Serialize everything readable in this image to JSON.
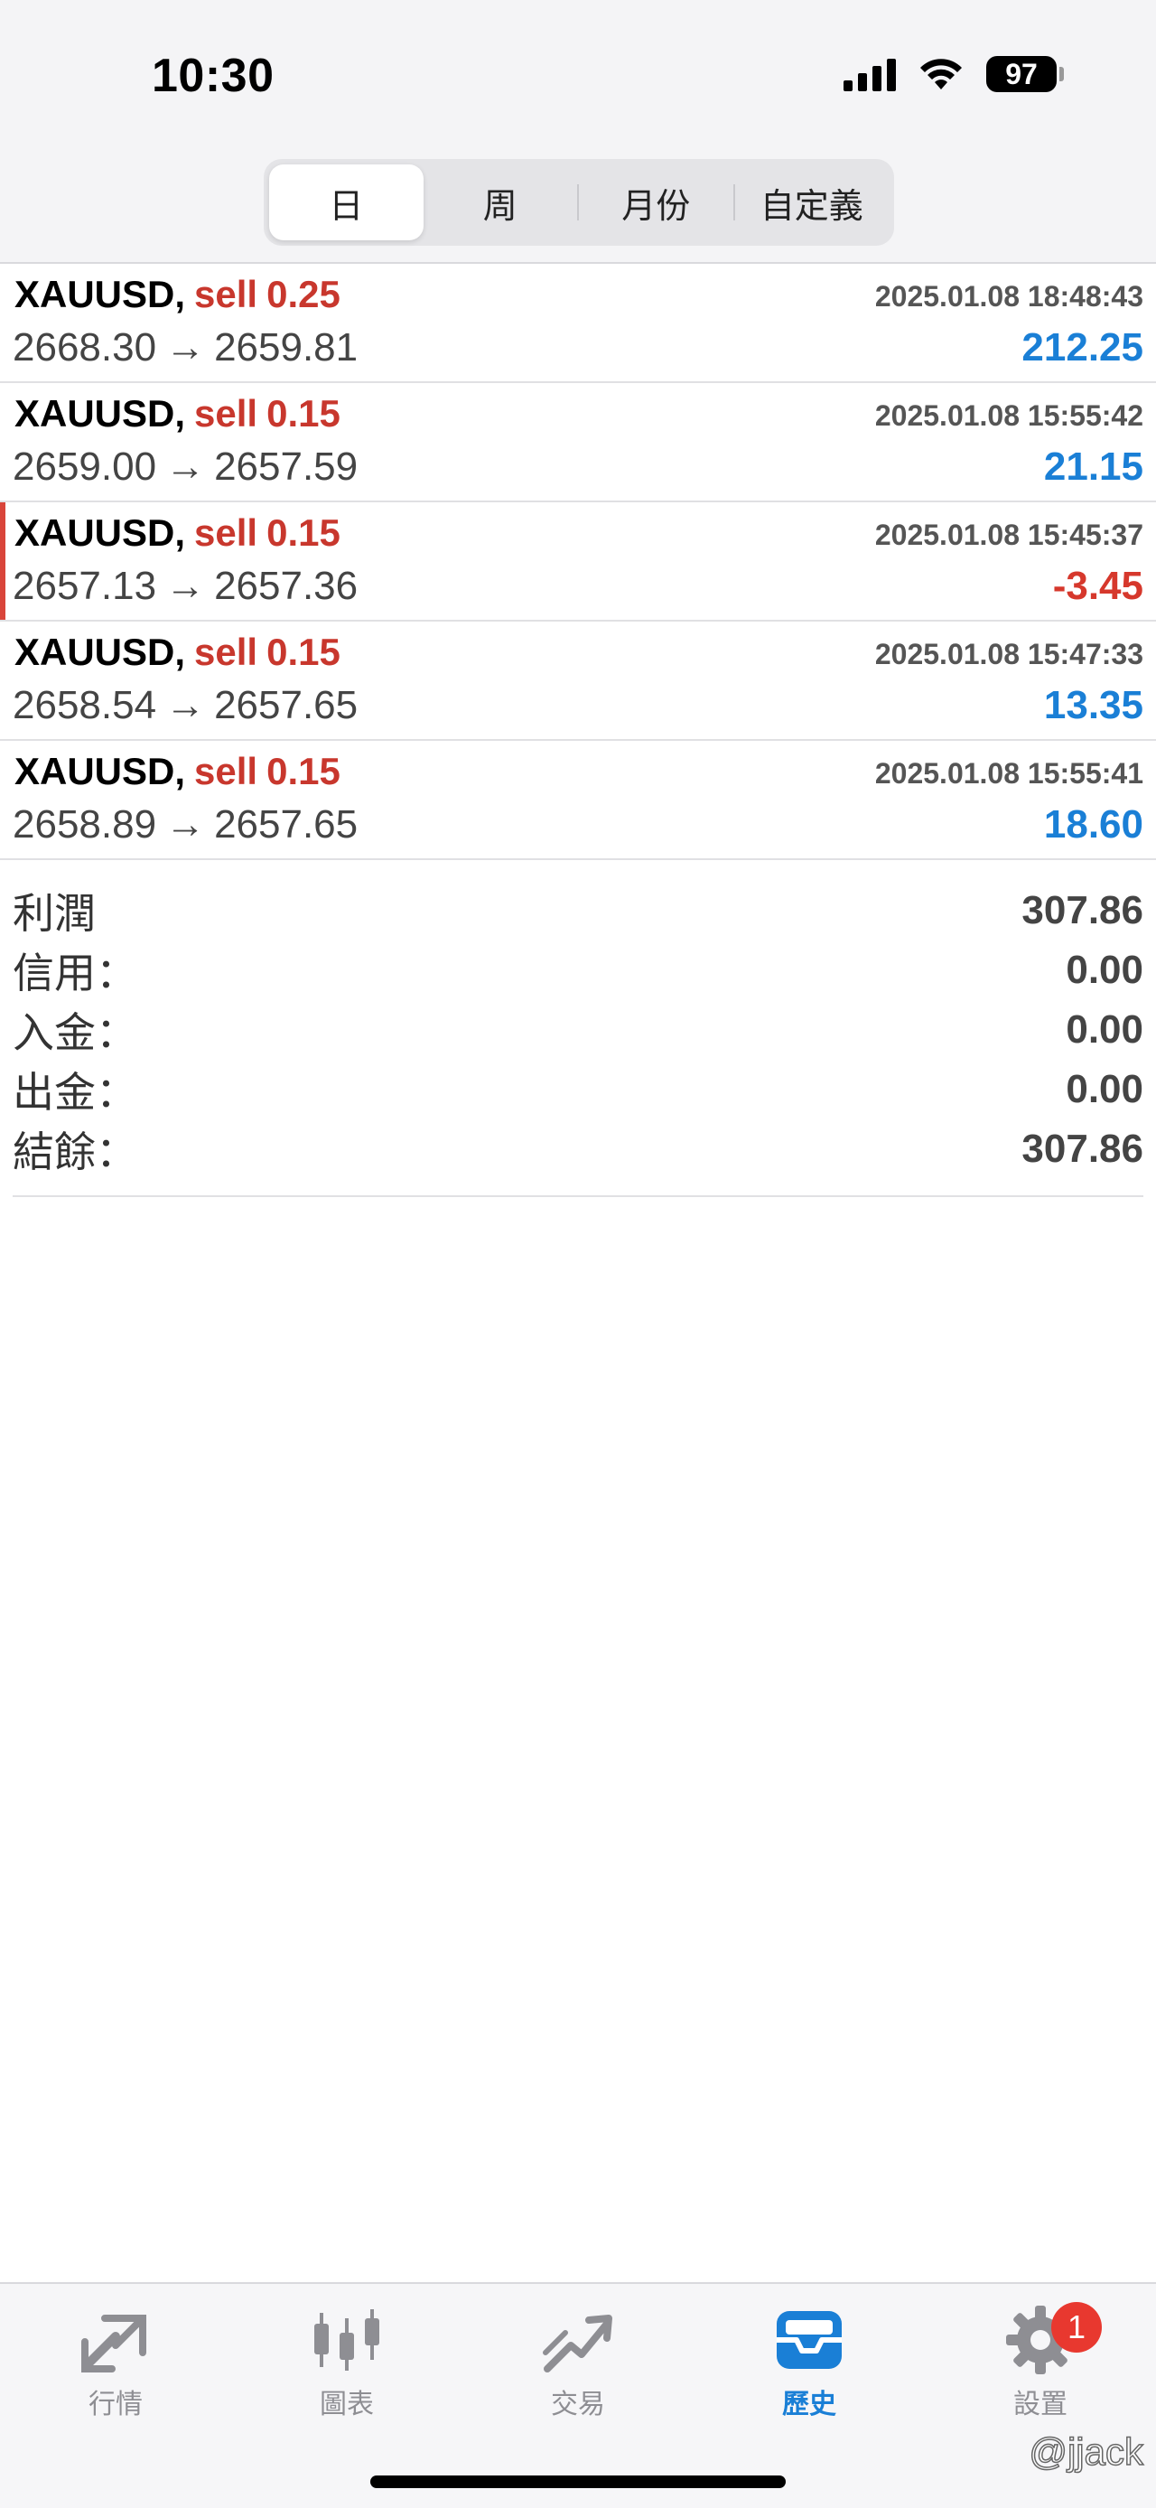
{
  "status_bar": {
    "time": "10:30",
    "battery": "97"
  },
  "period_tabs": [
    {
      "label": "日",
      "active": true
    },
    {
      "label": "周",
      "active": false
    },
    {
      "label": "月份",
      "active": false
    },
    {
      "label": "自定義",
      "active": false
    }
  ],
  "deals": [
    {
      "symbol": "XAUUSD",
      "side": "sell",
      "volume": "0.25",
      "time": "2025.01.08 18:48:43",
      "open_price": "2668.30",
      "close_price": "2659.81",
      "profit": "212.25"
    },
    {
      "symbol": "XAUUSD",
      "side": "sell",
      "volume": "0.15",
      "time": "2025.01.08 15:55:42",
      "open_price": "2659.00",
      "close_price": "2657.59",
      "profit": "21.15"
    },
    {
      "symbol": "XAUUSD",
      "side": "sell",
      "volume": "0.15",
      "time": "2025.01.08 15:45:37",
      "open_price": "2657.13",
      "close_price": "2657.36",
      "profit": "-3.45"
    },
    {
      "symbol": "XAUUSD",
      "side": "sell",
      "volume": "0.15",
      "time": "2025.01.08 15:47:33",
      "open_price": "2658.54",
      "close_price": "2657.65",
      "profit": "13.35"
    },
    {
      "symbol": "XAUUSD",
      "side": "sell",
      "volume": "0.15",
      "time": "2025.01.08 15:55:41",
      "open_price": "2658.89",
      "close_price": "2657.65",
      "profit": "18.60"
    }
  ],
  "summary": {
    "profit": {
      "label": "利潤",
      "value": "307.86"
    },
    "credit": {
      "label": "信用：",
      "value": "0.00"
    },
    "deposit": {
      "label": "入金：",
      "value": "0.00"
    },
    "withdrawal": {
      "label": "出金：",
      "value": "0.00"
    },
    "balance": {
      "label": "結餘：",
      "value": "307.86"
    }
  },
  "tabbar": [
    {
      "label": "行情",
      "icon": "quotes-arrows-icon",
      "active": false
    },
    {
      "label": "圖表",
      "icon": "candlestick-chart-icon",
      "active": false
    },
    {
      "label": "交易",
      "icon": "trade-trend-icon",
      "active": false
    },
    {
      "label": "歷史",
      "icon": "history-inbox-icon",
      "active": true
    },
    {
      "label": "設置",
      "icon": "settings-gear-icon",
      "active": false,
      "badge": "1"
    }
  ],
  "watermark": "@jjack",
  "colors": {
    "sell": "#c8372d",
    "profit_positive": "#1a7fd6",
    "profit_negative": "#d6382c",
    "tab_active": "#1a7fd6",
    "badge": "#e8382f"
  }
}
